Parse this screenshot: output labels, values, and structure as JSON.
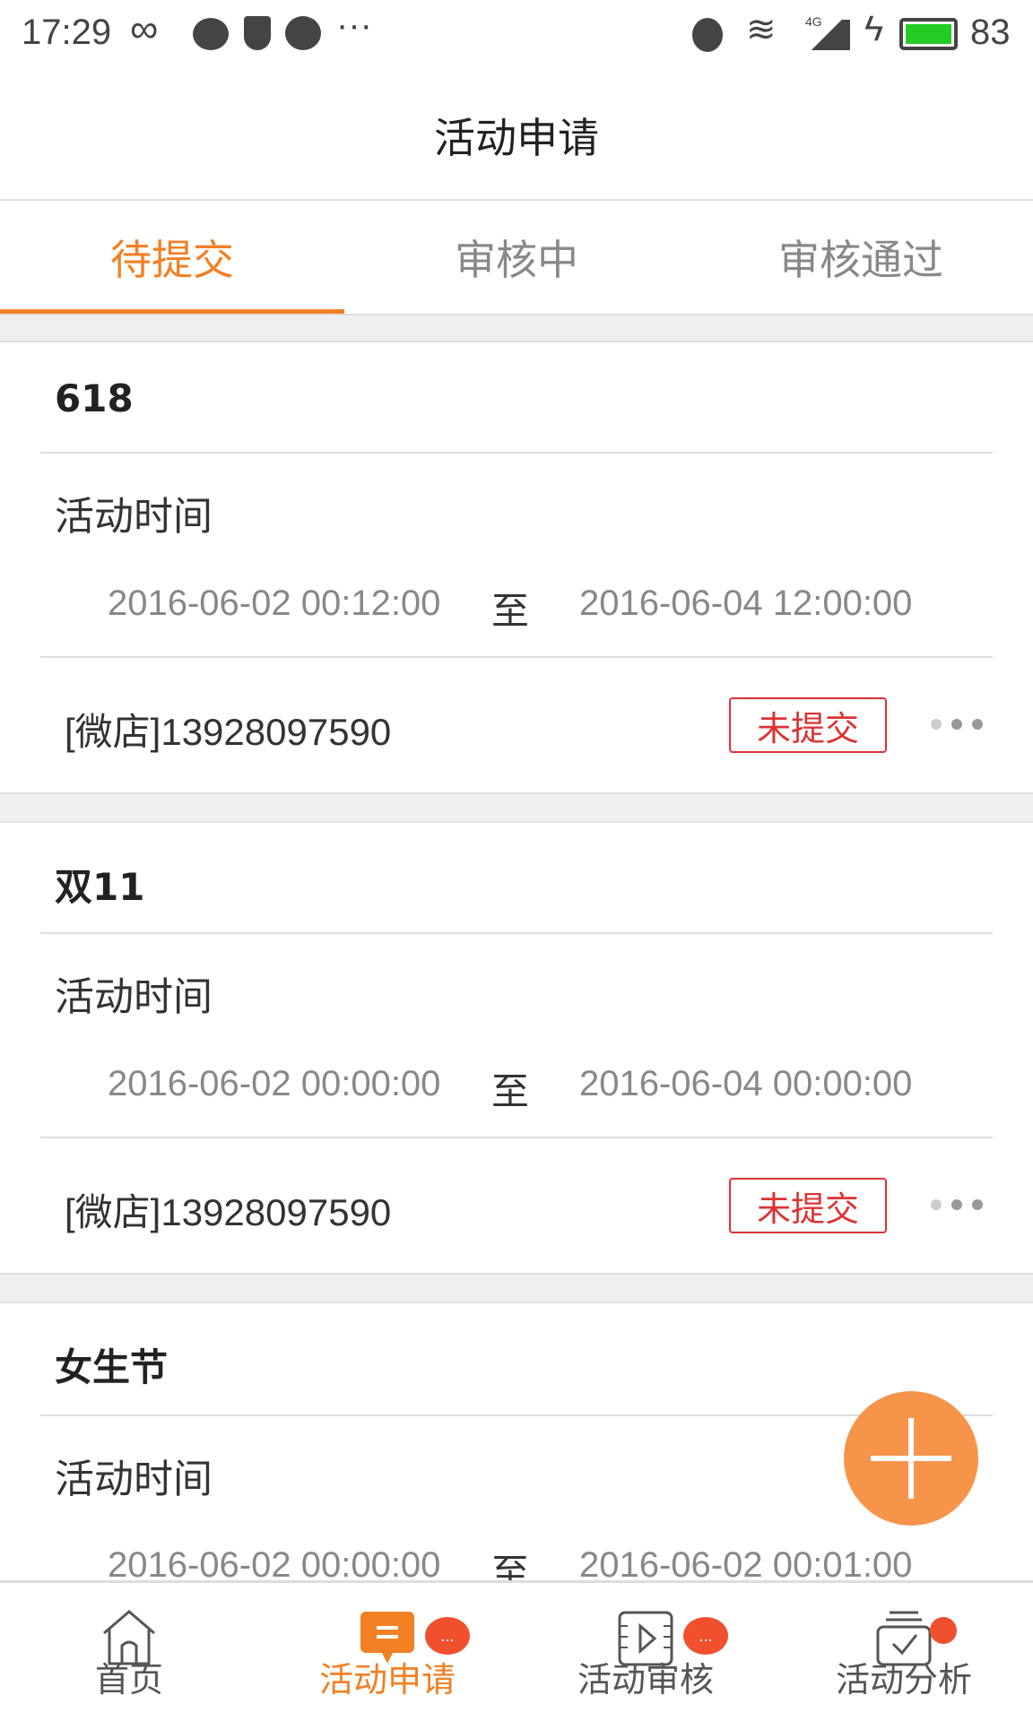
{
  "status_bar": {
    "time": "17:29",
    "battery": "83",
    "network": "4G",
    "icons": [
      "infinity-icon",
      "chat-bubble-icon",
      "shield-bolt-icon",
      "messenger-icon",
      "more-icon",
      "alarm-icon",
      "wifi-icon",
      "signal-icon",
      "charging-icon",
      "battery-icon"
    ]
  },
  "header": {
    "title": "活动申请"
  },
  "tabs": [
    {
      "label": "待提交",
      "active": true
    },
    {
      "label": "审核中"
    },
    {
      "label": "审核通过"
    }
  ],
  "cards": [
    {
      "title": "618",
      "time_label": "活动时间",
      "start": "2016-06-02 00:12:00",
      "to": "至",
      "end": "2016-06-04 12:00:00",
      "shop": "[微店]13928097590",
      "status": "未提交"
    },
    {
      "title": "双11",
      "time_label": "活动时间",
      "start": "2016-06-02 00:00:00",
      "to": "至",
      "end": "2016-06-04 00:00:00",
      "shop": "[微店]13928097590",
      "status": "未提交"
    },
    {
      "title": "女生节",
      "time_label": "活动时间",
      "start": "2016-06-02 00:00:00",
      "to": "至",
      "end": "2016-06-02 00:01:00"
    }
  ],
  "bottom_nav": [
    {
      "label": "首页",
      "icon": "home-icon"
    },
    {
      "label": "活动申请",
      "icon": "message-icon",
      "active": true,
      "badge": "..."
    },
    {
      "label": "活动审核",
      "icon": "video-review-icon",
      "badge": "..."
    },
    {
      "label": "活动分析",
      "icon": "checklist-icon",
      "badge_dot": true
    }
  ],
  "colors": {
    "accent": "#f28024",
    "badge_red": "#d33333",
    "fab": "#f6944a",
    "notification": "#f0502e",
    "battery": "#22cc22"
  }
}
